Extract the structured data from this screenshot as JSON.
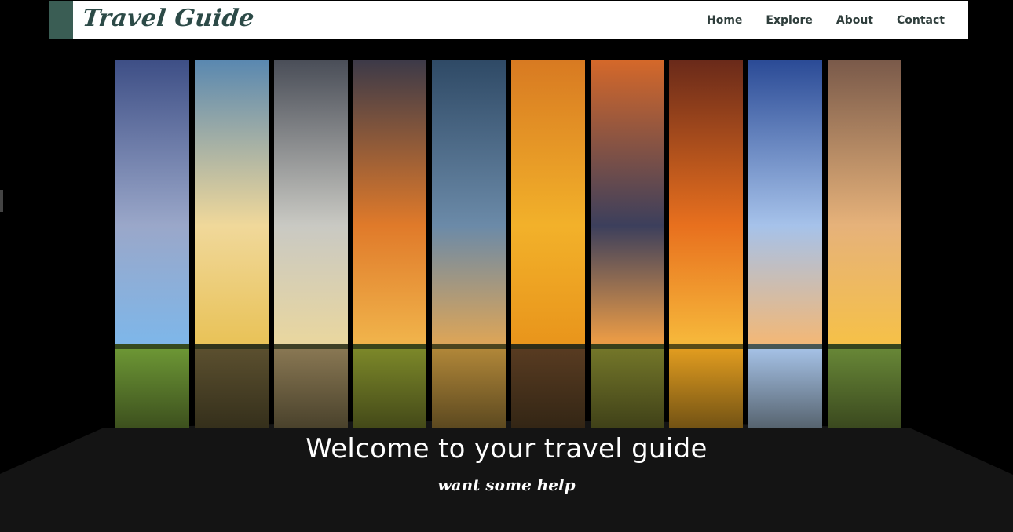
{
  "brand": "Travel Guide",
  "nav": {
    "items": [
      "Home",
      "Explore",
      "About",
      "Contact"
    ]
  },
  "hero": {
    "title": "Welcome to your travel guide",
    "tagline": "want some help"
  },
  "colors": {
    "accent": "#3a5d54",
    "brand_text": "#2c4a47",
    "nav_text": "#2e3d3b",
    "stage": "#141414"
  },
  "strips": [
    {
      "sky_top": "#3e4f86",
      "sky_mid": "#9aa7c9",
      "sky_low": "#7fb6e8",
      "ground": "#6f9a36"
    },
    {
      "sky_top": "#5a88b0",
      "sky_mid": "#f0d89a",
      "sky_low": "#e9c35a",
      "ground": "#5d5130"
    },
    {
      "sky_top": "#4a4e58",
      "sky_mid": "#c9c9c3",
      "sky_low": "#e8d6a0",
      "ground": "#8c7a55"
    },
    {
      "sky_top": "#3d3a48",
      "sky_mid": "#e07a2a",
      "sky_low": "#f0b24a",
      "ground": "#7f8b2a"
    },
    {
      "sky_top": "#2f4a66",
      "sky_mid": "#6b8aa8",
      "sky_low": "#d9a45a",
      "ground": "#b58a3a"
    },
    {
      "sky_top": "#d87a22",
      "sky_mid": "#f2b12a",
      "sky_low": "#e9961c",
      "ground": "#5a3c22"
    },
    {
      "sky_top": "#d4682a",
      "sky_mid": "#3c3f5c",
      "sky_low": "#e89a46",
      "ground": "#76792a"
    },
    {
      "sky_top": "#6a2a1a",
      "sky_mid": "#e8701e",
      "sky_low": "#f6b63a",
      "ground": "#e7a020"
    },
    {
      "sky_top": "#2b4b96",
      "sky_mid": "#a6c2ea",
      "sky_low": "#f0b87a",
      "ground": "#a9c6ec"
    },
    {
      "sky_top": "#7a5a4a",
      "sky_mid": "#e6b27a",
      "sky_low": "#f5c04a",
      "ground": "#6a8a38"
    }
  ]
}
